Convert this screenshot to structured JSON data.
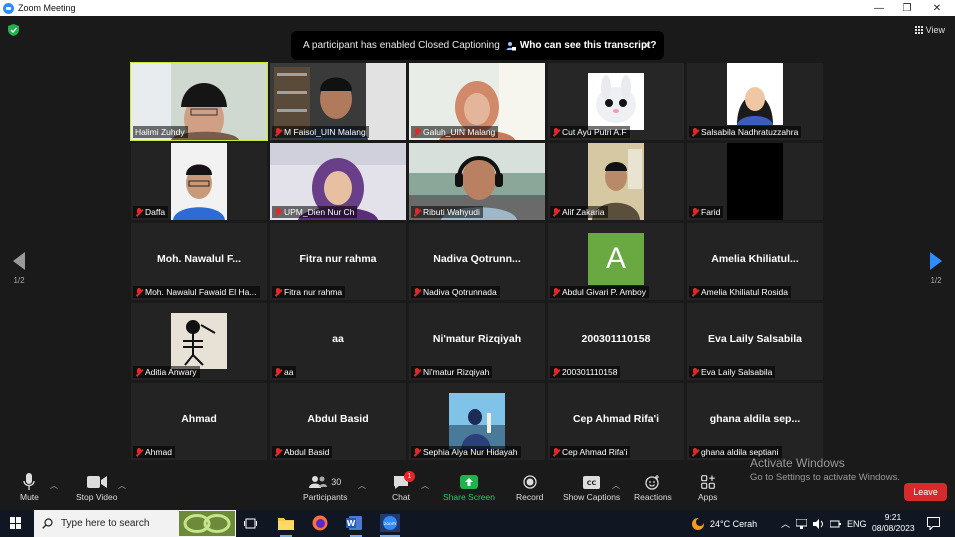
{
  "window": {
    "title": "Zoom Meeting",
    "minimize": "—",
    "restore": "❐",
    "close": "✕"
  },
  "view_label": "View",
  "cc_banner": {
    "message": "A participant has enabled Closed Captioning",
    "link": "Who can see this transcript?",
    "close": "✕"
  },
  "pager": {
    "left": "1/2",
    "right": "1/2"
  },
  "tiles": [
    {
      "caption": "Halimi Zuhdy",
      "big": "",
      "video": "man-cap",
      "active": true
    },
    {
      "caption": "M Faisol_UIN Malang",
      "big": "",
      "video": "man-bookshelf"
    },
    {
      "caption": "Galuh_UIN Malang",
      "big": "",
      "video": "woman-hijab-orange"
    },
    {
      "caption": "Cut Ayu Putri A.F",
      "big": "",
      "video": "bunny"
    },
    {
      "caption": "Salsabila Nadhratuzzahra",
      "big": "",
      "video": "girl-portrait"
    },
    {
      "caption": "Daffa",
      "big": "",
      "video": "man-glasses"
    },
    {
      "caption": "UPM_Dien Nur Ch",
      "big": "",
      "video": "woman-hijab-purple"
    },
    {
      "caption": "Ributi Wahyudi",
      "big": "",
      "video": "man-headset"
    },
    {
      "caption": "Alif Zakaria",
      "big": "",
      "video": "man-batik"
    },
    {
      "caption": "Farid",
      "big": "",
      "video": "black"
    },
    {
      "caption": "Moh. Nawalul Fawaid El Ha...",
      "big": "Moh.  Nawalul  F...",
      "video": ""
    },
    {
      "caption": "Fitra nur rahma",
      "big": "Fitra nur rahma",
      "video": ""
    },
    {
      "caption": "Nadiva Qotrunnada",
      "big": "Nadiva  Qotrunn...",
      "video": ""
    },
    {
      "caption": "Abdul Givari P. Amboy",
      "big": "",
      "video": "avatar-a",
      "avatar_letter": "A"
    },
    {
      "caption": "Amelia Khiliatul Rosida",
      "big": "Amelia  Khiliatul...",
      "video": ""
    },
    {
      "caption": "Aditia Anwary",
      "big": "",
      "video": "skeleton"
    },
    {
      "caption": "aa",
      "big": "aa",
      "video": ""
    },
    {
      "caption": "Ni'matur Rizqiyah",
      "big": "Ni'matur Rizqiyah",
      "video": ""
    },
    {
      "caption": "200301110158",
      "big": "200301110158",
      "video": ""
    },
    {
      "caption": "Eva Laily Salsabila",
      "big": "Eva Laily Salsabila",
      "video": ""
    },
    {
      "caption": "Ahmad",
      "big": "Ahmad",
      "video": ""
    },
    {
      "caption": "Abdul Basid",
      "big": "Abdul Basid",
      "video": ""
    },
    {
      "caption": "Sephia Alya Nur Hidayah",
      "big": "",
      "video": "outdoor-photo"
    },
    {
      "caption": "Cep Ahmad Rifa'i",
      "big": "Cep Ahmad Rifa'i",
      "video": ""
    },
    {
      "caption": "ghana aldila septiani",
      "big": "ghana  aldila  sep...",
      "video": ""
    }
  ],
  "toolbar": {
    "mute": "Mute",
    "stop_video": "Stop Video",
    "participants": "Participants",
    "participants_count": "30",
    "chat": "Chat",
    "chat_badge": "1",
    "share_screen": "Share Screen",
    "record": "Record",
    "show_captions": "Show Captions",
    "reactions": "Reactions",
    "apps": "Apps",
    "leave": "Leave"
  },
  "watermark": {
    "line1": "Activate Windows",
    "line2": "Go to Settings to activate Windows."
  },
  "taskbar": {
    "search_placeholder": "Type here to search",
    "weather": "24°C  Cerah",
    "language": "ENG",
    "time": "9:21",
    "date": "08/08/2023"
  },
  "colors": {
    "active_speaker": "#c7e93a",
    "accent": "#2d8cff",
    "leave": "#d72b2b",
    "share": "#22b14c",
    "muted": "#e02828"
  }
}
